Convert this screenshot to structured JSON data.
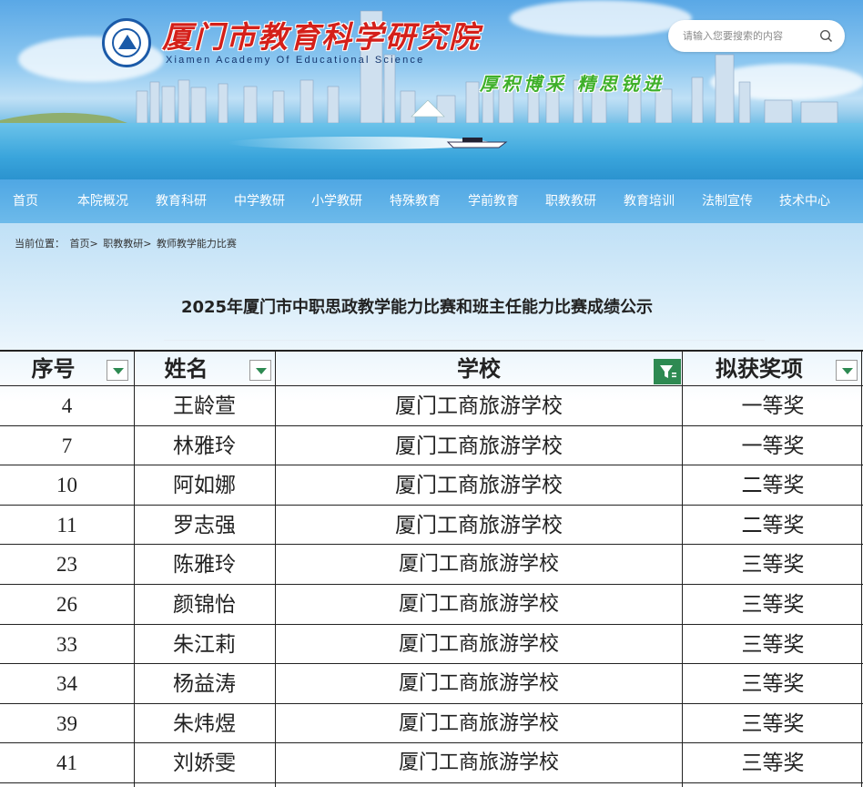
{
  "site": {
    "title": "厦门市教育科学研究院",
    "subtitle": "Xiamen Academy Of Educational Science",
    "slogan": "厚积博采  精思锐进"
  },
  "search": {
    "placeholder": "请输入您要搜索的内容"
  },
  "nav": [
    {
      "label": "首页"
    },
    {
      "label": "本院概况"
    },
    {
      "label": "教育科研"
    },
    {
      "label": "中学教研"
    },
    {
      "label": "小学教研"
    },
    {
      "label": "特殊教育"
    },
    {
      "label": "学前教育"
    },
    {
      "label": "职教教研"
    },
    {
      "label": "教育培训"
    },
    {
      "label": "法制宣传"
    },
    {
      "label": "技术中心"
    }
  ],
  "breadcrumb": {
    "prefix": "当前位置：",
    "items": [
      "首页>",
      "职教教研>",
      "教师教学能力比赛"
    ]
  },
  "article": {
    "title": "2025年厦门市中职思政教学能力比赛和班主任能力比赛成绩公示"
  },
  "table": {
    "headers": [
      "序号",
      "姓名",
      "学校",
      "拟获奖项"
    ],
    "rows": [
      {
        "no": "4",
        "name": "王龄萱",
        "school": "厦门工商旅游学校",
        "award": "一等奖"
      },
      {
        "no": "7",
        "name": "林雅玲",
        "school": "厦门工商旅游学校",
        "award": "一等奖"
      },
      {
        "no": "10",
        "name": "阿如娜",
        "school": "厦门工商旅游学校",
        "award": "二等奖"
      },
      {
        "no": "11",
        "name": "罗志强",
        "school": "厦门工商旅游学校",
        "award": "二等奖"
      },
      {
        "no": "23",
        "name": "陈雅玲",
        "school": "厦门工商旅游学校",
        "award": "三等奖"
      },
      {
        "no": "26",
        "name": "颜锦怡",
        "school": "厦门工商旅游学校",
        "award": "三等奖"
      },
      {
        "no": "33",
        "name": "朱江莉",
        "school": "厦门工商旅游学校",
        "award": "三等奖"
      },
      {
        "no": "34",
        "name": "杨益涛",
        "school": "厦门工商旅游学校",
        "award": "三等奖"
      },
      {
        "no": "39",
        "name": "朱炜煜",
        "school": "厦门工商旅游学校",
        "award": "三等奖"
      },
      {
        "no": "41",
        "name": "刘娇雯",
        "school": "厦门工商旅游学校",
        "award": "三等奖"
      }
    ]
  },
  "colors": {
    "title_red": "#d4201a",
    "slogan_green": "#3fb02a",
    "nav_blue": "#4fa7e4",
    "filter_green": "#2e8a52"
  }
}
